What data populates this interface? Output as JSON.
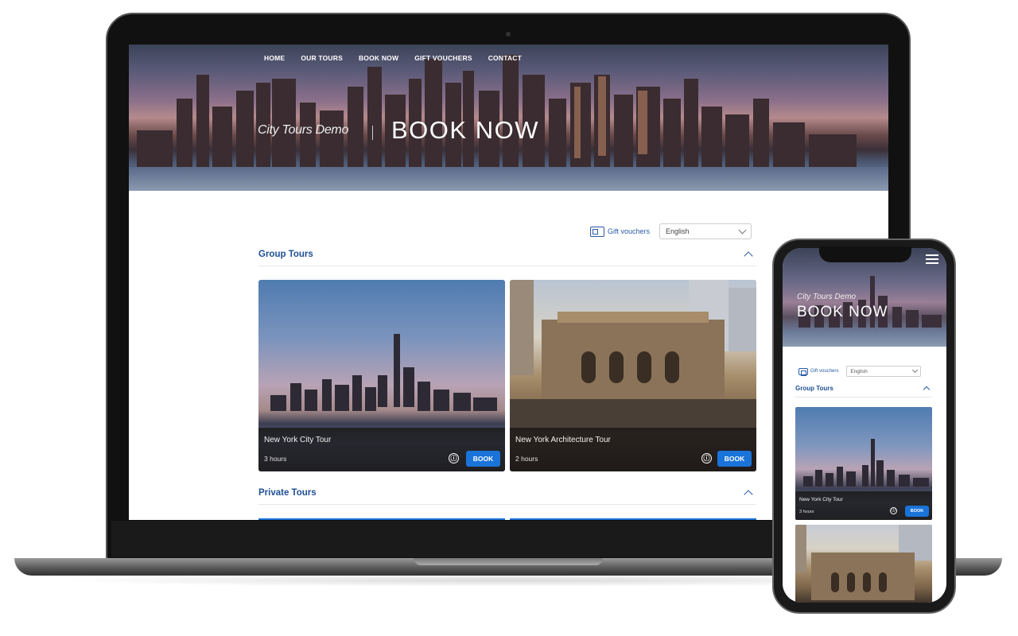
{
  "desktop": {
    "nav": [
      "HOME",
      "OUR TOURS",
      "BOOK NOW",
      "GIFT VOUCHERS",
      "CONTACT"
    ],
    "brand": "City Tours Demo",
    "hero_title": "BOOK NOW",
    "gift_vouchers_label": "Gift vouchers",
    "language": "English",
    "sections": [
      {
        "title": "Group Tours",
        "tours": [
          {
            "title": "New York City Tour",
            "duration": "3 hours",
            "button": "BOOK",
            "info_icon": "ⓘ"
          },
          {
            "title": "New York Architecture Tour",
            "duration": "2 hours",
            "button": "BOOK",
            "info_icon": "ⓘ"
          }
        ]
      },
      {
        "title": "Private Tours"
      }
    ]
  },
  "mobile": {
    "brand": "City Tours Demo",
    "hero_title": "BOOK NOW",
    "gift_vouchers_label": "Gift vouchers",
    "language": "English",
    "section_title": "Group Tours",
    "tour": {
      "title": "New York City Tour",
      "duration": "3 hours",
      "button": "BOOK",
      "info_icon": "ⓘ"
    }
  },
  "colors": {
    "accent": "#1a73d9",
    "heading": "#1f4f95"
  }
}
